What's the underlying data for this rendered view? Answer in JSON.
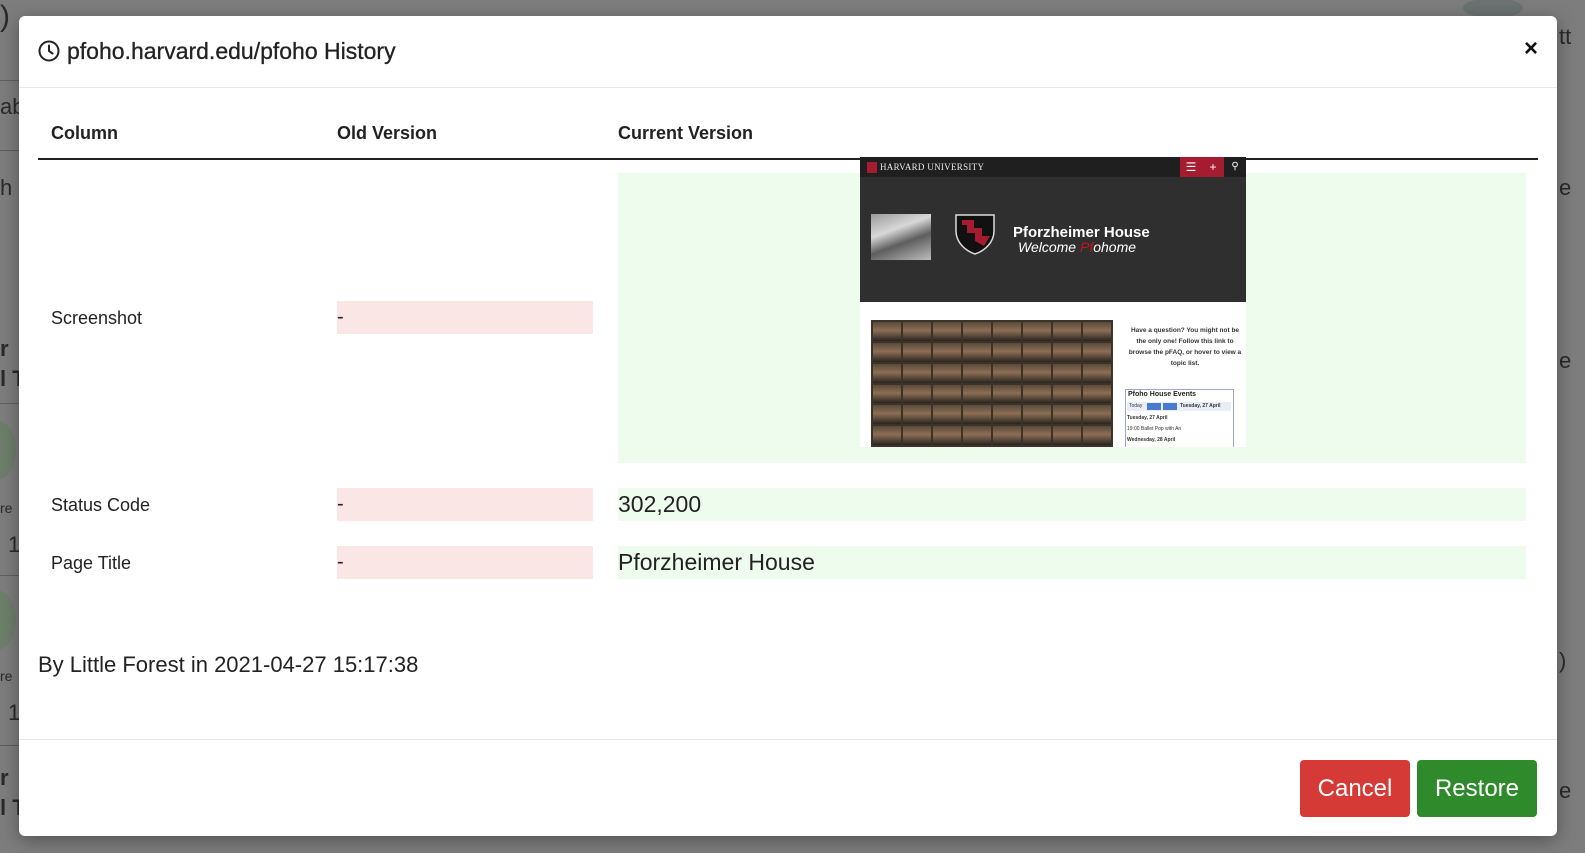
{
  "modal": {
    "title": "pfoho.harvard.edu/pfoho History",
    "close_label": "×"
  },
  "table": {
    "headers": [
      "Column",
      "Old Version",
      "Current Version"
    ],
    "rows": [
      {
        "column": "Screenshot",
        "old": "-",
        "current": ""
      },
      {
        "column": "Status Code",
        "old": "-",
        "current": "302,200"
      },
      {
        "column": "Page Title",
        "old": "-",
        "current": "Pforzheimer House"
      }
    ]
  },
  "screenshot_thumb": {
    "university": "HARVARD UNIVERSITY",
    "site_name": "Pforzheimer House",
    "welcome_prefix": "Welcome ",
    "welcome_red": "Pf",
    "welcome_suffix": "ohome",
    "question_text": "Have a question? You might not be the only one! Follow this link to browse the pFAQ, or hover to view a topic list.",
    "events_title": "Pfoho House Events",
    "events_today": "Today",
    "events_date": "Tuesday, 27 April",
    "events_day1": "Tuesday, 27 April",
    "events_item": "19:00     Ballet Pop with An",
    "events_day2": "Wednesday, 28 April"
  },
  "footer": {
    "attribution": "By Little Forest in 2021-04-27 15:17:38",
    "cancel_label": "Cancel",
    "restore_label": "Restore"
  },
  "colors": {
    "cancel": "#d53a36",
    "restore": "#2f8a2c",
    "old_bg": "#fbe6e6",
    "new_bg": "#eefcee"
  }
}
